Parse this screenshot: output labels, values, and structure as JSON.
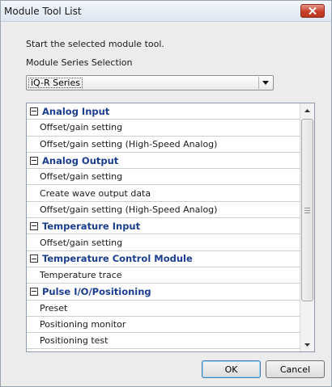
{
  "window": {
    "title": "Module Tool List",
    "close_icon": "close-icon",
    "close_color": "#c9402a"
  },
  "description": "Start the selected module tool.",
  "series_selection": {
    "label": "Module Series Selection",
    "selected": "iQ-R Series"
  },
  "tool_list": {
    "groups": [
      {
        "label": "Analog Input",
        "items": [
          "Offset/gain setting",
          "Offset/gain setting (High-Speed Analog)"
        ]
      },
      {
        "label": "Analog Output",
        "items": [
          "Offset/gain setting",
          "Create wave output data",
          "Offset/gain setting (High-Speed Analog)"
        ]
      },
      {
        "label": "Temperature Input",
        "items": [
          "Offset/gain setting"
        ]
      },
      {
        "label": "Temperature Control Module",
        "items": [
          "Temperature trace"
        ]
      },
      {
        "label": "Pulse I/O/Positioning",
        "items": [
          "Preset",
          "Positioning monitor",
          "Positioning test"
        ]
      }
    ],
    "group_label_color": "#1b3d8f"
  },
  "buttons": {
    "ok_label": "OK",
    "cancel_label": "Cancel"
  }
}
